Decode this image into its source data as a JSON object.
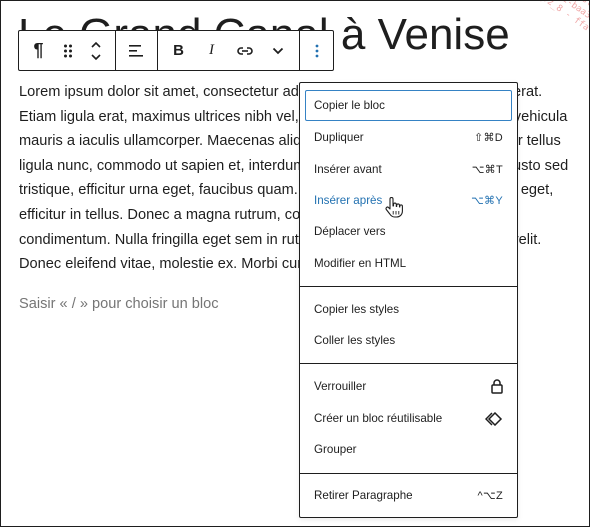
{
  "page": {
    "heading": "Le Grand Canal à Venise",
    "watermark": [
      "6-test-c",
      "4761-baa3-",
      "test_v2_8 - ffa"
    ],
    "paragraph": "Lorem ipsum dolor sit amet, consectetur adipiscing elit. Vestibulum et ipsum erat. Etiam ligula erat, maximus ultrices nibh vel, tincidunt venenatis nunc. Sed at vehicula mauris a iaculis ullamcorper. Maecenas aliquam felis id ullamcorper. Curabitur tellus ligula nunc, commodo ut sapien et, interdum blandit leo. Nullam elementum justo sed tristique, efficitur urna eget, faucibus quam. Ut ipsum quam, mollis ac tempus eget, efficitur in tellus. Donec a magna rutrum, consectetur lectus vitae, tristique condimentum. Nulla fringilla eget sem in rutrum. Vestibulum nec elementum velit. Donec eleifend vitae, molestie ex. Morbi cursus justo felis, vel cursus nulla.",
    "placeholder": "Saisir « / » pour choisir un bloc"
  },
  "toolbar": {
    "buttons": [
      {
        "name": "paragraph-icon",
        "glyph": "¶"
      },
      {
        "name": "drag-handle-icon"
      },
      {
        "name": "move-up-down-icon"
      },
      {
        "name": "align-left-icon"
      },
      {
        "name": "bold-icon",
        "glyph": "B"
      },
      {
        "name": "italic-icon",
        "glyph": "I"
      },
      {
        "name": "link-icon"
      },
      {
        "name": "chevron-down-icon"
      },
      {
        "name": "more-options-icon"
      }
    ]
  },
  "menu": {
    "items": [
      {
        "label": "Copier le bloc",
        "shortcut": "",
        "state": "focused"
      },
      {
        "label": "Dupliquer",
        "shortcut": "⇧⌘D",
        "state": ""
      },
      {
        "label": "Insérer avant",
        "shortcut": "⌥⌘T",
        "state": ""
      },
      {
        "label": "Insérer après",
        "shortcut": "⌥⌘Y",
        "state": "active"
      },
      {
        "label": "Déplacer vers",
        "shortcut": "",
        "state": ""
      },
      {
        "label": "Modifier en HTML",
        "shortcut": "",
        "state": ""
      },
      {
        "label": "Copier les styles",
        "shortcut": "",
        "state": ""
      },
      {
        "label": "Coller les styles",
        "shortcut": "",
        "state": ""
      },
      {
        "label": "Verrouiller",
        "icon": "lock-icon",
        "state": ""
      },
      {
        "label": "Créer un bloc réutilisable",
        "icon": "reusable-block-icon",
        "state": ""
      },
      {
        "label": "Grouper",
        "shortcut": "",
        "state": ""
      },
      {
        "label": "Retirer Paragraphe",
        "shortcut": "^⌥Z",
        "state": ""
      }
    ]
  },
  "colors": {
    "accent": "#2271b1",
    "focus_ring": "#3582c4",
    "text": "#1e1e1e",
    "placeholder": "#757575"
  }
}
